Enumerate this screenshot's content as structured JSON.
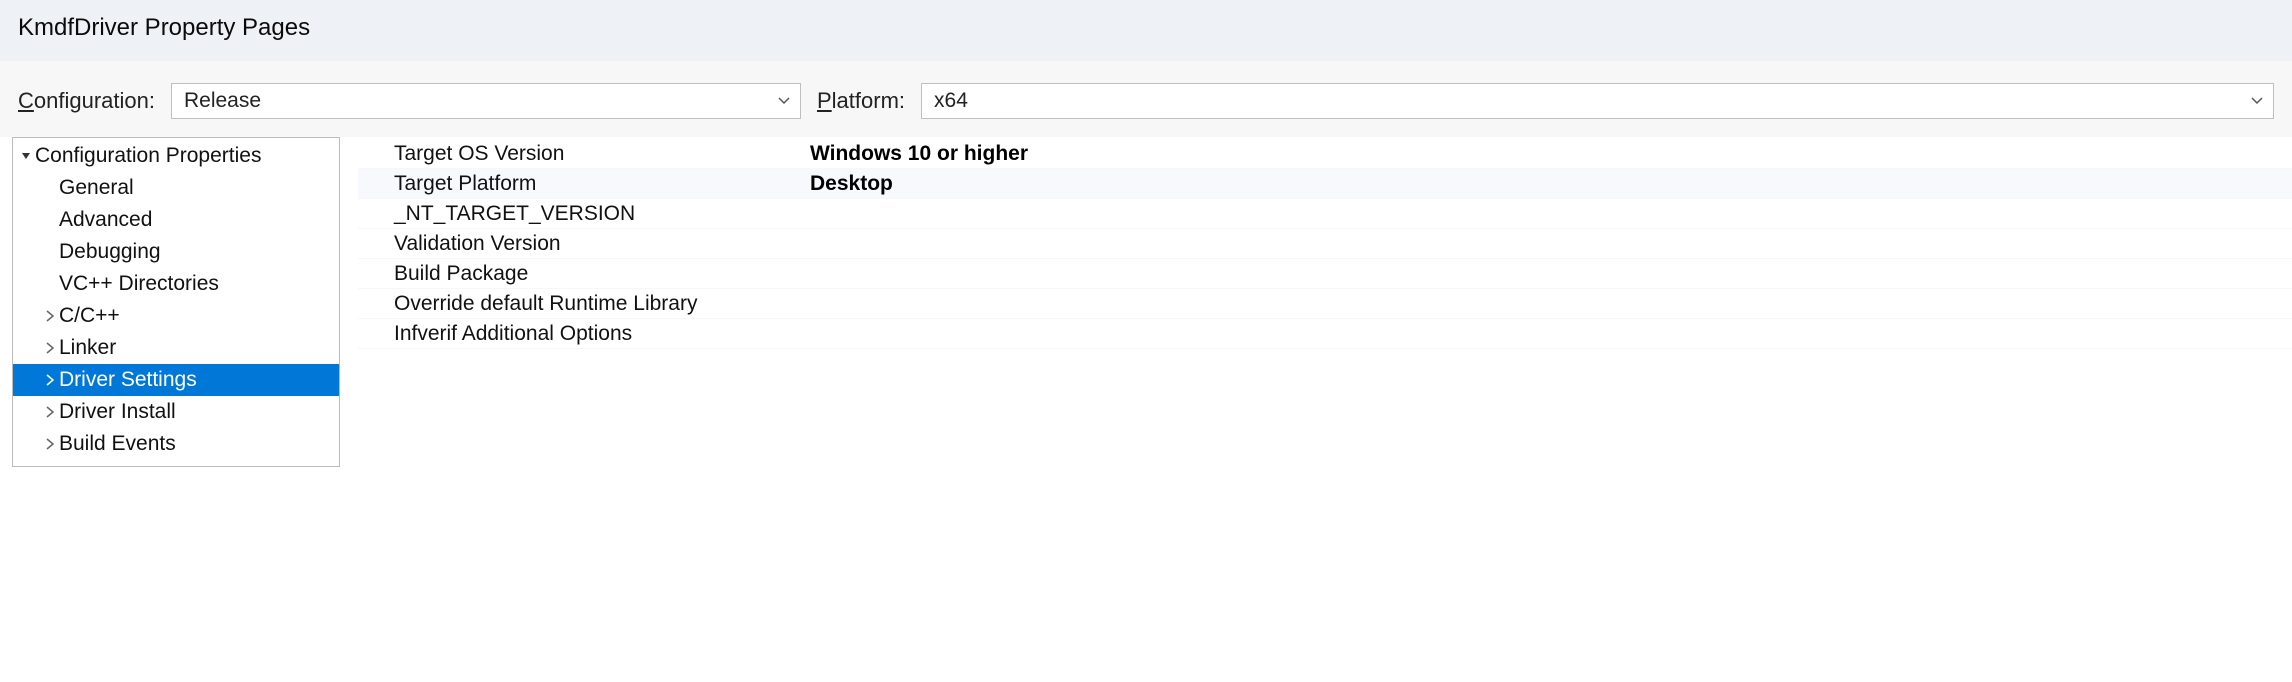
{
  "window": {
    "title": "KmdfDriver Property Pages"
  },
  "toolbar": {
    "configuration_label_pre": "C",
    "configuration_label_post": "onfiguration:",
    "configuration_value": "Release",
    "platform_label_pre": "P",
    "platform_label_post": "latform:",
    "platform_value": "x64"
  },
  "tree": {
    "root_label": "Configuration Properties",
    "items": [
      {
        "label": "General",
        "expandable": false,
        "selected": false
      },
      {
        "label": "Advanced",
        "expandable": false,
        "selected": false
      },
      {
        "label": "Debugging",
        "expandable": false,
        "selected": false
      },
      {
        "label": "VC++ Directories",
        "expandable": false,
        "selected": false
      },
      {
        "label": "C/C++",
        "expandable": true,
        "selected": false
      },
      {
        "label": "Linker",
        "expandable": true,
        "selected": false
      },
      {
        "label": "Driver Settings",
        "expandable": true,
        "selected": true
      },
      {
        "label": "Driver Install",
        "expandable": true,
        "selected": false
      },
      {
        "label": "Build Events",
        "expandable": true,
        "selected": false
      }
    ]
  },
  "grid": {
    "rows": [
      {
        "name": "Target OS Version",
        "value": "Windows 10 or higher",
        "bold": true,
        "alt": false
      },
      {
        "name": "Target Platform",
        "value": "Desktop",
        "bold": true,
        "alt": true
      },
      {
        "name": "_NT_TARGET_VERSION",
        "value": "",
        "bold": false,
        "alt": false
      },
      {
        "name": "Validation Version",
        "value": "",
        "bold": false,
        "alt": false
      },
      {
        "name": "Build Package",
        "value": "",
        "bold": false,
        "alt": false
      },
      {
        "name": "Override default Runtime Library",
        "value": "",
        "bold": false,
        "alt": false
      },
      {
        "name": "Infverif Additional Options",
        "value": "",
        "bold": false,
        "alt": false
      }
    ]
  }
}
